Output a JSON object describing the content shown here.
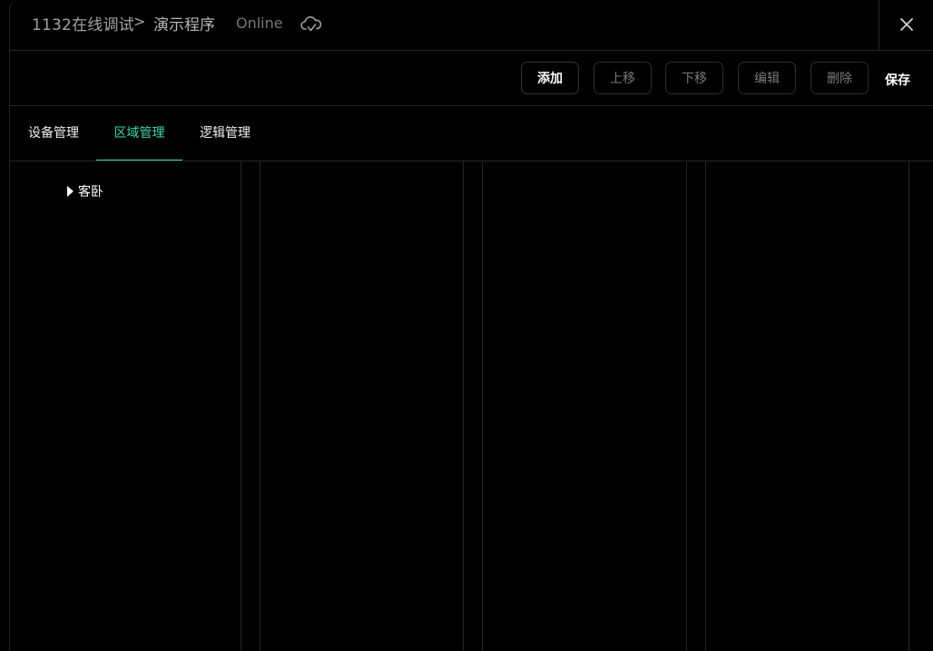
{
  "header": {
    "project": "1132在线调试",
    "separator": ">",
    "program": "演示程序",
    "status": "Online",
    "status_icon": "cloud-check-icon",
    "close_icon": "close-icon"
  },
  "toolbar": {
    "add_label": "添加",
    "move_up_label": "上移",
    "move_down_label": "下移",
    "edit_label": "编辑",
    "delete_label": "删除",
    "save_label": "保存"
  },
  "tabs": [
    {
      "label": "设备管理",
      "selected": false
    },
    {
      "label": "区域管理",
      "selected": true
    },
    {
      "label": "逻辑管理",
      "selected": false
    }
  ],
  "tree": {
    "items": [
      {
        "label": "客卧",
        "expanded": false
      }
    ]
  },
  "colors": {
    "background": "#000000",
    "accent": "#3fd6b0",
    "border": "#262626"
  }
}
